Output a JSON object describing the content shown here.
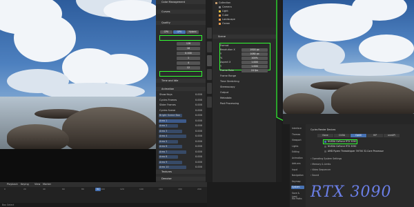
{
  "left_view": {
    "timeline": {
      "menu": [
        "Playback",
        "Keying",
        "View",
        "Marker"
      ],
      "frames": [
        "0",
        "20",
        "40",
        "60",
        "80",
        "100",
        "120",
        "140",
        "160",
        "180",
        "200"
      ],
      "current_frame": "84",
      "status": "Box Select"
    }
  },
  "left_panel": {
    "rows": [
      {
        "label": "Color Management"
      },
      {
        "label": "Film"
      },
      {
        "label": "Curves"
      },
      {
        "label": "Quality"
      }
    ],
    "sections": [
      "Color Management",
      "Stereoscopy",
      "Freestyle",
      "Light Paths",
      "Sampling",
      "Time and Idle",
      "Animation",
      "Render",
      "Textures",
      "Denoise"
    ],
    "render_tabs": [
      "CPU",
      "GPU",
      "Hybrid"
    ],
    "anim_list": [
      "Show Keys",
      "Cycles Frames",
      "Slider Frames",
      "Cycles Scene",
      "Bright Scene Box",
      "Area 1",
      "Area 2",
      "Area 3",
      "Area 4",
      "Area 5",
      "Area 6",
      "Area 7",
      "Area 8",
      "Area 9",
      "Area 10"
    ],
    "values": [
      "0.000",
      "0.000",
      "0.000",
      "0.000",
      "0.000",
      "0.000",
      "0.000",
      "0.000",
      "0.000",
      "0.000",
      "0.000",
      "0.000",
      "0.000",
      "0.000",
      "0.000"
    ]
  },
  "outliner": {
    "items": [
      "Collection",
      "Camera",
      "Light",
      "Cube",
      "Landscape",
      "Ocean"
    ]
  },
  "props": {
    "header": "Scene",
    "sections": [
      {
        "label": "Format"
      },
      {
        "label": "Resolution X",
        "value": "1920 px"
      },
      {
        "label": "Y",
        "value": "1080 px"
      },
      {
        "label": "%",
        "value": "100%"
      },
      {
        "label": "Aspect X",
        "value": "1.000"
      },
      {
        "label": "Y",
        "value": "1.000"
      },
      {
        "label": "Frame Rate",
        "value": "24 fps"
      },
      {
        "label": "Frame Range"
      },
      {
        "label": "Time Stretching"
      },
      {
        "label": "Stereoscopy"
      },
      {
        "label": "Output"
      },
      {
        "label": "Metadata"
      },
      {
        "label": "Post Processing"
      }
    ]
  },
  "preferences": {
    "sidebar": [
      "Interface",
      "Themes",
      "Viewport",
      "Lights",
      "Editing",
      "Animation",
      "Add-ons",
      "Input",
      "Navigation",
      "Keymap",
      "System",
      "Save & Load",
      "File Paths"
    ],
    "active_side": "System",
    "section_title": "Cycles Render Devices",
    "tabs": [
      "None",
      "CUDA",
      "OptiX",
      "HIP",
      "oneAPI"
    ],
    "active_tab": "OptiX",
    "devices": [
      {
        "label": "NVIDIA GeForce RTX 3090",
        "checked": true
      },
      {
        "label": "NVIDIA GeForce RTX 3090",
        "checked": false
      },
      {
        "label": "AMD Ryzen Threadripper 3970X 32-Core Processor",
        "checked": false
      }
    ],
    "more_sections": [
      "Operating System Settings",
      "Memory & Limits",
      "Video Sequencer",
      "Sound"
    ],
    "annotation": "RTX 3090"
  },
  "colors": {
    "highlight": "#33ff33",
    "accent": "#4772b3"
  }
}
